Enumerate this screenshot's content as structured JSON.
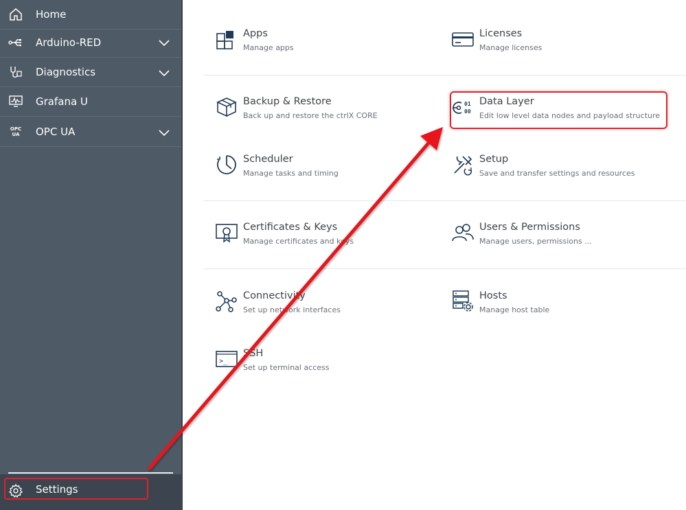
{
  "sidebar": {
    "items": [
      {
        "label": "Home",
        "icon": "home-icon"
      },
      {
        "label": "Arduino-RED",
        "icon": "usb-plug-icon"
      },
      {
        "label": "Diagnostics",
        "icon": "stethoscope-icon"
      },
      {
        "label": "Grafana U",
        "icon": "monitor-chart-icon"
      },
      {
        "label": "OPC UA",
        "icon": "opc-ua-icon"
      }
    ],
    "opc_icon_text_top": "OPC",
    "opc_icon_text_bottom": "UA",
    "settings_label": "Settings"
  },
  "tiles": [
    {
      "title": "Apps",
      "subtitle": "Manage apps",
      "icon": "apps-grid-icon"
    },
    {
      "title": "Licenses",
      "subtitle": "Manage licenses",
      "icon": "credit-card-icon"
    },
    {
      "title": "Backup & Restore",
      "subtitle": "Back up and restore the ctrlX CORE",
      "icon": "box-icon"
    },
    {
      "title": "Data Layer",
      "subtitle": "Edit low level data nodes and payload structure",
      "icon": "data-layer-icon"
    },
    {
      "title": "Scheduler",
      "subtitle": "Manage tasks and timing",
      "icon": "clock-icon"
    },
    {
      "title": "Setup",
      "subtitle": "Save and transfer settings and resources",
      "icon": "tools-icon"
    },
    {
      "title": "Certificates & Keys",
      "subtitle": "Manage certificates and keys",
      "icon": "certificate-icon"
    },
    {
      "title": "Users & Permissions",
      "subtitle": "Manage users, permissions ...",
      "icon": "users-icon"
    },
    {
      "title": "Connectivity",
      "subtitle": "Set up network interfaces",
      "icon": "network-icon"
    },
    {
      "title": "Hosts",
      "subtitle": "Manage host table",
      "icon": "server-icon"
    },
    {
      "title": "SSH",
      "subtitle": "Set up terminal access",
      "icon": "terminal-icon"
    }
  ],
  "data_layer_icon_bits_top": "01",
  "data_layer_icon_bits_bottom": "00",
  "terminal_icon_text": ">_",
  "colors": {
    "sidebar": "#4e5a66",
    "highlight": "#e3202a",
    "icon": "#1f3a55"
  }
}
